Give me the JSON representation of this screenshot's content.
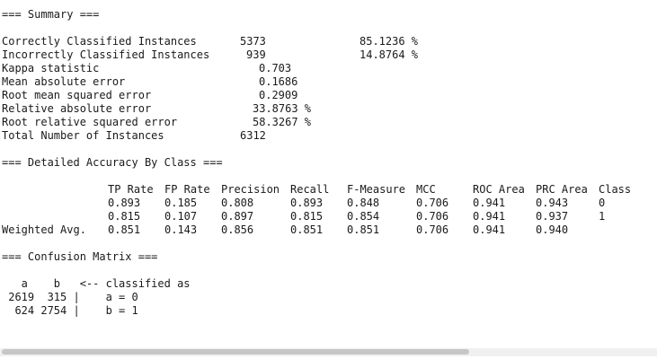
{
  "summary": {
    "header": "=== Summary ===",
    "rows": [
      {
        "label": "Correctly Classified Instances",
        "value": "5373",
        "percent": "85.1236 %"
      },
      {
        "label": "Incorrectly Classified Instances",
        "value": "939",
        "percent": "14.8764 %"
      },
      {
        "label": "Kappa statistic",
        "value": "0.703"
      },
      {
        "label": "Mean absolute error",
        "value": "0.1686"
      },
      {
        "label": "Root mean squared error",
        "value": "0.2909"
      },
      {
        "label": "Relative absolute error",
        "value": "33.8763 %"
      },
      {
        "label": "Root relative squared error",
        "value": "58.3267 %"
      },
      {
        "label": "Total Number of Instances",
        "value": "6312"
      }
    ]
  },
  "detailed": {
    "header": "=== Detailed Accuracy By Class ===",
    "columns": [
      "TP Rate",
      "FP Rate",
      "Precision",
      "Recall",
      "F-Measure",
      "MCC",
      "ROC Area",
      "PRC Area",
      "Class"
    ],
    "rows": [
      {
        "label": "",
        "cells": [
          "0.893",
          "0.185",
          "0.808",
          "0.893",
          "0.848",
          "0.706",
          "0.941",
          "0.943",
          "0"
        ]
      },
      {
        "label": "",
        "cells": [
          "0.815",
          "0.107",
          "0.897",
          "0.815",
          "0.854",
          "0.706",
          "0.941",
          "0.937",
          "1"
        ]
      },
      {
        "label": "Weighted Avg.",
        "cells": [
          "0.851",
          "0.143",
          "0.856",
          "0.851",
          "0.851",
          "0.706",
          "0.941",
          "0.940",
          ""
        ]
      }
    ]
  },
  "confusion": {
    "header": "=== Confusion Matrix ===",
    "header_line": "   a    b   <-- classified as",
    "lines": [
      " 2619  315 |    a = 0",
      "  624 2754 |    b = 1"
    ]
  }
}
